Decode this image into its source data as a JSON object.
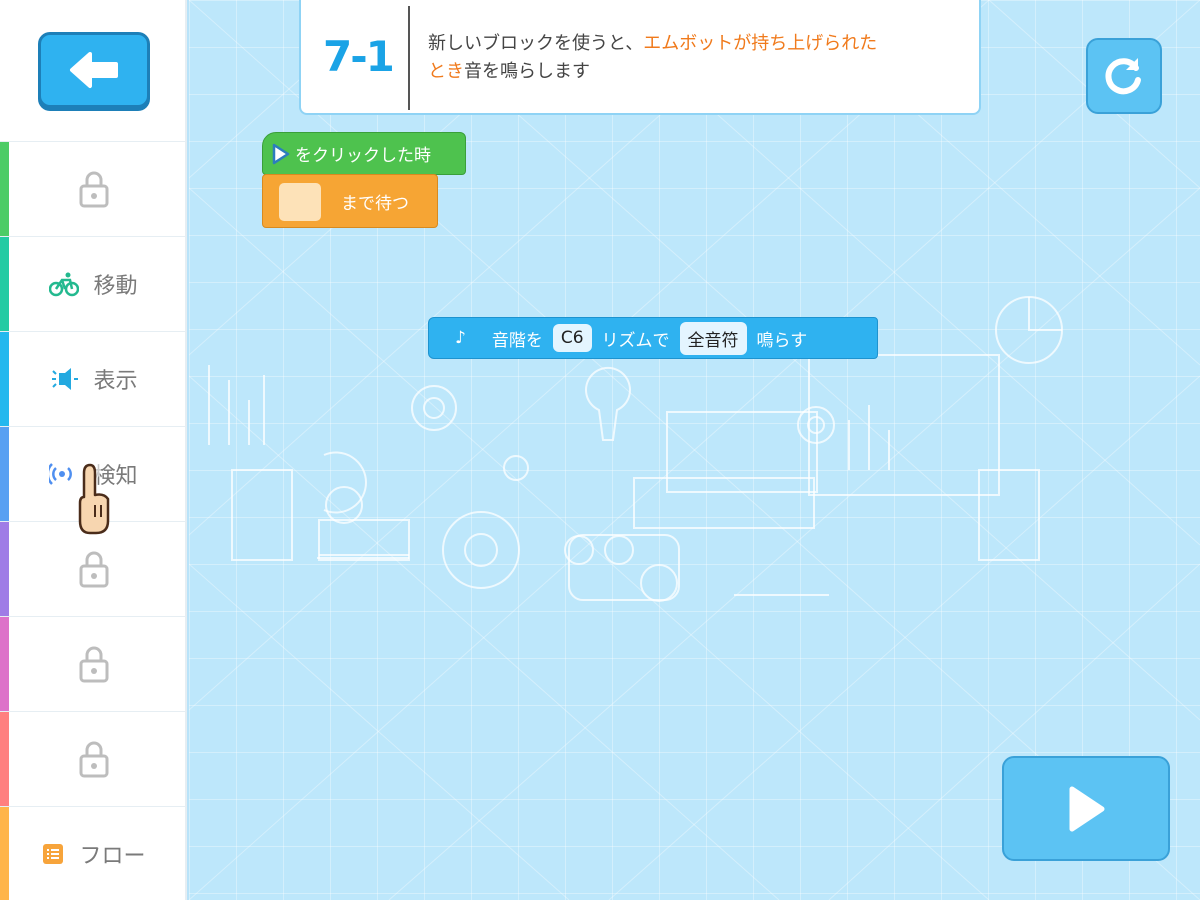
{
  "sidebar": {
    "back_label": "",
    "categories": [
      {
        "label": "",
        "icon": "lock-icon",
        "locked": true,
        "color": "#4ccc66"
      },
      {
        "label": "移動",
        "icon": "bicycle-icon",
        "locked": false,
        "color": "#23cba3"
      },
      {
        "label": "表示",
        "icon": "light-icon",
        "locked": false,
        "color": "#23b8ee"
      },
      {
        "label": "検知",
        "icon": "sensor-icon",
        "locked": false,
        "color": "#58a0f2"
      },
      {
        "label": "",
        "icon": "lock-icon",
        "locked": true,
        "color": "#9f7ce6"
      },
      {
        "label": "",
        "icon": "lock-icon",
        "locked": true,
        "color": "#dd72c9"
      },
      {
        "label": "",
        "icon": "lock-icon",
        "locked": true,
        "color": "#ff7f7f"
      },
      {
        "label": "フロー",
        "icon": "flow-icon",
        "locked": false,
        "color": "#ffb54a"
      }
    ]
  },
  "task": {
    "number": "7-1",
    "text_before": "新しいブロックを使うと、",
    "text_highlight_1": "エムボットが持ち上げられた",
    "text_highlight_2": "とき",
    "text_after": "音を鳴らします"
  },
  "blocks": {
    "hat_label": "をクリックした時",
    "wait_label": "まで待つ",
    "sound": {
      "note_symbol": "♪",
      "label_1": "音階を",
      "note_value": "C6",
      "label_2": "リズムで",
      "rhythm_value": "全音符",
      "label_3": "鳴らす"
    }
  },
  "colors": {
    "accent": "#2fb2f0",
    "highlight": "#f07a1c",
    "hat_block": "#4ec24e",
    "wait_block": "#f6a534",
    "canvas_bg": "#bde7fb"
  }
}
